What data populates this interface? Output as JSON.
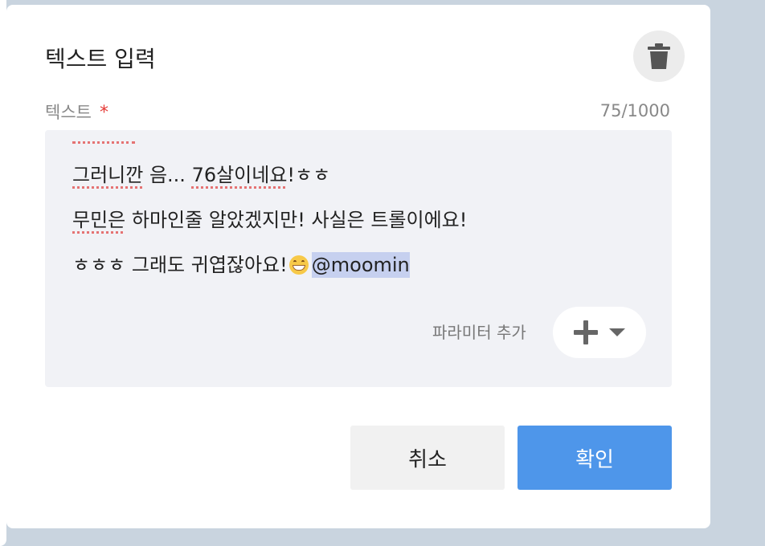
{
  "dialog": {
    "title": "텍스트 입력",
    "delete_icon": "trash-icon"
  },
  "field": {
    "label": "텍스트",
    "required_mark": "*",
    "counter": "75/1000"
  },
  "text": {
    "line1_a": "그러니깐",
    "line1_b": " 음... ",
    "line1_c": "76살이네요",
    "line1_d": "!ㅎㅎ",
    "line2_a": "무민은",
    "line2_b": " 하마인줄 알았겠지만! 사실은 트롤이에요!",
    "line3_a": "ㅎㅎㅎ 그래도 귀엽잖아요!",
    "line3_emoji": "grinning-face-emoji",
    "line3_mention": "@moomin"
  },
  "parameter": {
    "label": "파라미터 추가",
    "add_icon": "plus-icon",
    "dropdown_icon": "caret-down-icon"
  },
  "buttons": {
    "cancel": "취소",
    "confirm": "확인"
  },
  "colors": {
    "primary": "#4e96ea",
    "required": "#e53935",
    "mention_highlight": "#c6d0ef",
    "spellcheck": "#e57373"
  }
}
